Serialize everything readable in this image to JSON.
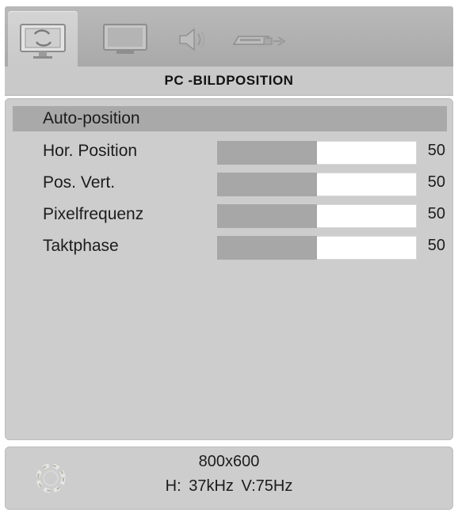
{
  "tabs": [
    {
      "icon": "pc-monitor-refresh-icon",
      "active": true
    },
    {
      "icon": "tv-screen-icon",
      "active": false
    },
    {
      "icon": "speaker-sound-icon",
      "active": false
    },
    {
      "icon": "source-connector-icon",
      "active": false
    }
  ],
  "header": {
    "title": "PC -BILDPOSITION"
  },
  "menu": {
    "items": [
      {
        "label": "Auto-position"
      },
      {
        "label": "Hor. Position",
        "value": "50",
        "level": 0.5
      },
      {
        "label": "Pos. Vert.",
        "value": "50",
        "level": 0.5
      },
      {
        "label": "Pixelfrequenz",
        "value": "50",
        "level": 0.5
      },
      {
        "label": "Taktphase",
        "value": "50",
        "level": 0.5
      }
    ]
  },
  "info": {
    "resolution": "800x600",
    "frequency": "H: 37kHz V:75Hz",
    "icon": "signal-reticle-icon"
  },
  "colors": {
    "panel": "#cdcdcd",
    "selected_row": "#a9a9a9",
    "slider_fill": "#a7a7a7",
    "slider_track": "#ffffff"
  }
}
